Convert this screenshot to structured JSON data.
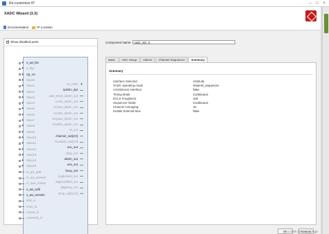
{
  "window": {
    "title": "Re-customize IP"
  },
  "header": {
    "ip_title": "XADC Wizard (3.3)"
  },
  "links": {
    "documentation": "Documentation",
    "ip_location": "IP Location"
  },
  "left_panel": {
    "show_disabled_ports": "Show disabled ports"
  },
  "ports_left": [
    {
      "label": "s_axi_lite",
      "active": true,
      "conn": "+"
    },
    {
      "label": "s_drp",
      "active": false,
      "conn": "+"
    },
    {
      "label": "Vp_Vn",
      "active": true,
      "conn": "+"
    },
    {
      "label": "Vaux0",
      "active": false,
      "conn": "+"
    },
    {
      "label": "Vaux1",
      "active": false,
      "conn": "+"
    },
    {
      "label": "Vaux2",
      "active": false,
      "conn": "+"
    },
    {
      "label": "Vaux3",
      "active": false,
      "conn": "+"
    },
    {
      "label": "Vaux4",
      "active": false,
      "conn": "+"
    },
    {
      "label": "Vaux5",
      "active": false,
      "conn": "+"
    },
    {
      "label": "Vaux6",
      "active": false,
      "conn": "+"
    },
    {
      "label": "Vaux7",
      "active": false,
      "conn": "+"
    },
    {
      "label": "Vaux8",
      "active": false,
      "conn": "+"
    },
    {
      "label": "Vaux9",
      "active": false,
      "conn": "+"
    },
    {
      "label": "Vaux10",
      "active": false,
      "conn": "+"
    },
    {
      "label": "Vaux11",
      "active": false,
      "conn": "+"
    },
    {
      "label": "Vaux12",
      "active": false,
      "conn": "+"
    },
    {
      "label": "Vaux13",
      "active": false,
      "conn": "+"
    },
    {
      "label": "Vaux14",
      "active": false,
      "conn": "+"
    },
    {
      "label": "Vaux15",
      "active": false,
      "conn": "+"
    },
    {
      "label": "m_axi_aclk",
      "active": false,
      "conn": ""
    },
    {
      "label": "m_axi_aresetn",
      "active": false,
      "conn": ""
    },
    {
      "label": "m_axis_tready",
      "active": false,
      "conn": ""
    },
    {
      "label": "s_axi_aclk",
      "active": true,
      "conn": ""
    },
    {
      "label": "s_axi_aresetn",
      "active": true,
      "conn": ""
    },
    {
      "label": "dclk_in",
      "active": false,
      "conn": ""
    },
    {
      "label": "reset_in",
      "active": false,
      "conn": ""
    },
    {
      "label": "convst_in",
      "active": false,
      "conn": ""
    },
    {
      "label": "convstclk_in",
      "active": false,
      "conn": ""
    }
  ],
  "ports_right": [
    {
      "label": "M_AXIS",
      "active": false,
      "conn": "+"
    },
    {
      "label": "ip2intc_irpt",
      "active": true,
      "conn": ""
    },
    {
      "label": "user_temp_alarm_out",
      "active": false,
      "conn": ""
    },
    {
      "label": "vccint_alarm_out",
      "active": false,
      "conn": ""
    },
    {
      "label": "vccaux_alarm_out",
      "active": false,
      "conn": ""
    },
    {
      "label": "vccpint_alarm_out",
      "active": false,
      "conn": ""
    },
    {
      "label": "vccpaux_alarm_out",
      "active": false,
      "conn": ""
    },
    {
      "label": "vccddro_alarm_out",
      "active": false,
      "conn": ""
    },
    {
      "label": "ot_out",
      "active": false,
      "conn": ""
    },
    {
      "label": "channel_out[4:0]",
      "active": true,
      "conn": ""
    },
    {
      "label": "muxaddr_out[4:0]",
      "active": false,
      "conn": ""
    },
    {
      "label": "eoc_out",
      "active": true,
      "conn": ""
    },
    {
      "label": "drdy_out",
      "active": false,
      "conn": ""
    },
    {
      "label": "alarm_out",
      "active": true,
      "conn": ""
    },
    {
      "label": "eos_out",
      "active": true,
      "conn": ""
    },
    {
      "label": "busy_out",
      "active": true,
      "conn": ""
    },
    {
      "label": "jtaglocked_out",
      "active": false,
      "conn": ""
    },
    {
      "label": "jtagmodified_out",
      "active": false,
      "conn": ""
    },
    {
      "label": "jtagbusy_out",
      "active": false,
      "conn": ""
    },
    {
      "label": "temp_out[11:0]",
      "active": false,
      "conn": ""
    }
  ],
  "component_name": {
    "label": "Component Name",
    "value": "xadc_wiz_0"
  },
  "tabs": [
    "Basic",
    "ADC Setup",
    "Alarms",
    "Channel Sequencer",
    "Summary"
  ],
  "active_tab": "Summary",
  "summary": {
    "title": "Summary",
    "rows": [
      {
        "key": "Interface Selected",
        "value": "AXI4Lite"
      },
      {
        "key": "XADC operating mode",
        "value": "channel_sequencer"
      },
      {
        "key": "AXI4Stream Interface",
        "value": "false"
      },
      {
        "key": "Timing Mode",
        "value": "Continuous"
      },
      {
        "key": "DCLK Freq(MHz)",
        "value": "100"
      },
      {
        "key": "Sequencer Mode",
        "value": "Continuous"
      },
      {
        "key": "Channel Averaging",
        "value": "16"
      },
      {
        "key": "Enable External Mux",
        "value": "false"
      }
    ]
  },
  "buttons": {
    "ok": "OK",
    "cancel": "Cancel"
  },
  "watermark": "CSDN @Hrmmx_Rgjn"
}
